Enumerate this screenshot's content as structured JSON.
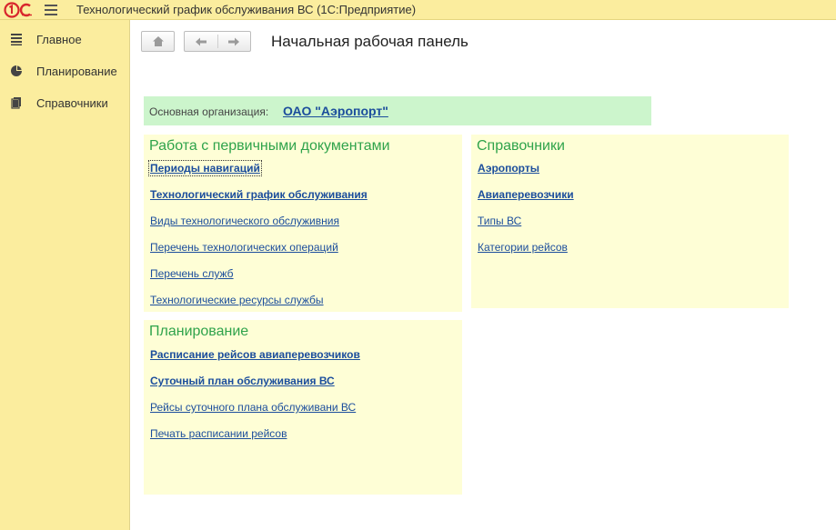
{
  "window": {
    "title": "Технологический график обслуживания ВС  (1С:Предприятие)",
    "logo_text": "1С"
  },
  "sidebar": {
    "items": [
      {
        "label": "Главное",
        "icon": "list-icon"
      },
      {
        "label": "Планирование",
        "icon": "pie-chart-icon"
      },
      {
        "label": "Справочники",
        "icon": "books-icon"
      }
    ]
  },
  "toolbar": {
    "home_icon": "home-icon",
    "back_icon": "arrow-left-icon",
    "forward_icon": "arrow-right-icon"
  },
  "page": {
    "title": "Начальная рабочая панель"
  },
  "organization": {
    "label": "Основная организация:",
    "value": "ОАО \"Аэропорт\""
  },
  "panels": {
    "documents": {
      "title": "Работа с первичными документами",
      "links": [
        {
          "label": "Периоды навигаций",
          "bold": true
        },
        {
          "label": "Технологический график обслуживания",
          "bold": true
        },
        {
          "label": "Виды технологического обслуживния",
          "bold": false
        },
        {
          "label": "Перечень технологических операций",
          "bold": false
        },
        {
          "label": "Перечень служб",
          "bold": false
        },
        {
          "label": "Технологические ресурсы службы",
          "bold": false
        }
      ]
    },
    "references": {
      "title": "Справочники",
      "links": [
        {
          "label": "Аэропорты",
          "bold": true
        },
        {
          "label": "Авиаперевозчики",
          "bold": true
        },
        {
          "label": "Типы ВС",
          "bold": false
        },
        {
          "label": "Категории рейсов",
          "bold": false
        }
      ]
    },
    "planning": {
      "title": "Планирование",
      "links": [
        {
          "label": "Расписание рейсов авиаперевозчиков",
          "bold": true
        },
        {
          "label": "Суточный план обслуживания ВС",
          "bold": true
        },
        {
          "label": "Рейсы суточного плана обслуживани ВС",
          "bold": false
        },
        {
          "label": "Печать расписании рейсов",
          "bold": false
        }
      ]
    }
  },
  "colors": {
    "titlebar": "#fbed9e",
    "sidebar": "#fbed9e",
    "org_panel": "#ccf5cc",
    "section_panel": "#fefed6",
    "section_title": "#2fa34b",
    "link": "#1b4d9c",
    "logo": "#d8262c"
  }
}
